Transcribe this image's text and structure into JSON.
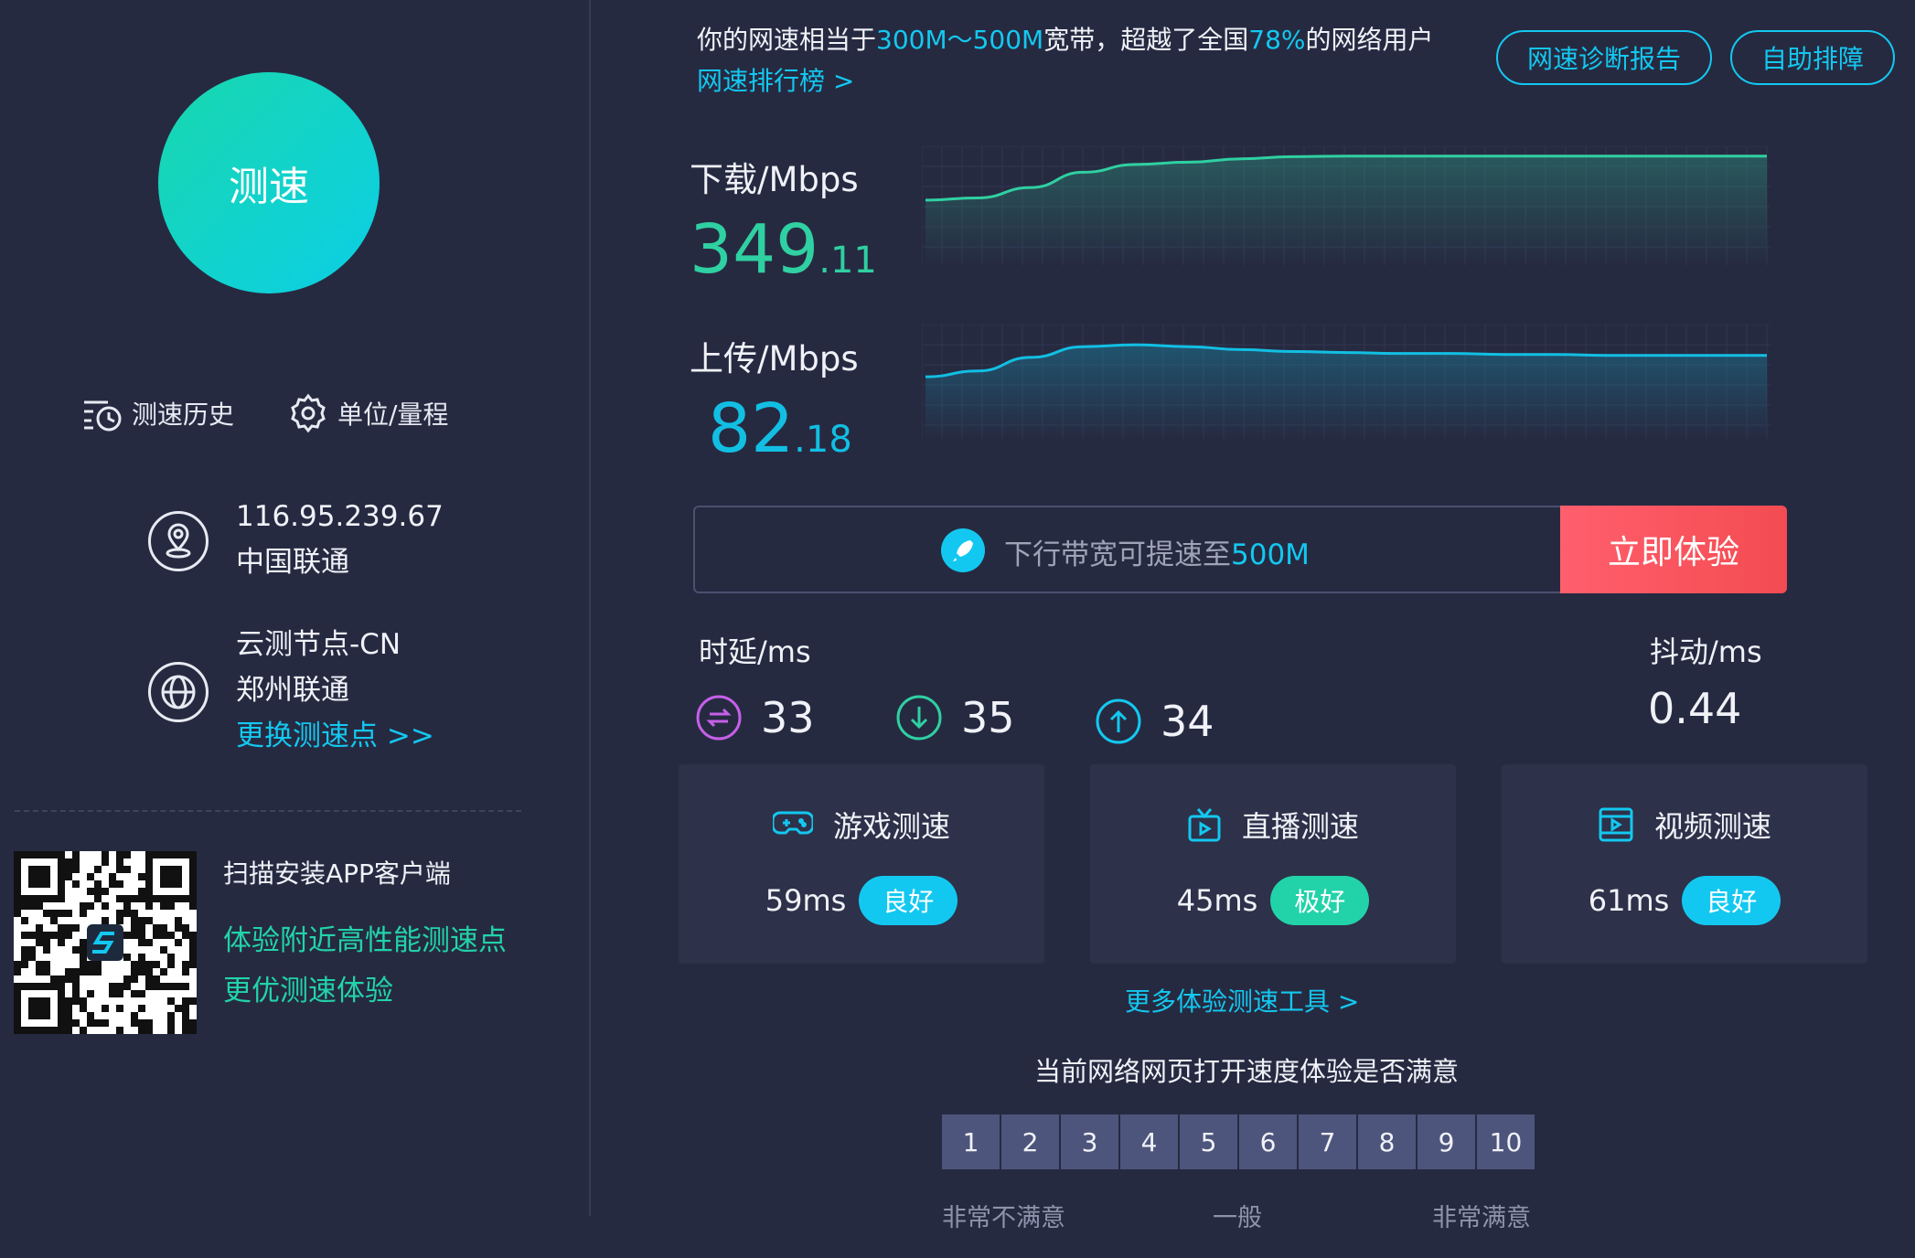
{
  "left": {
    "start_button": "测速",
    "tools": {
      "history": "测速历史",
      "units": "单位/量程"
    },
    "ip": {
      "address": "116.95.239.67",
      "isp": "中国联通"
    },
    "node": {
      "name": "云测节点-CN",
      "location": "郑州联通",
      "change_link": "更换测速点 >>"
    },
    "qr": {
      "title": "扫描安装APP客户端",
      "line1": "体验附近高性能测速点",
      "line2": "更优测速体验"
    }
  },
  "summary": {
    "prefix": "你的网速相当于",
    "bandwidth": "300M～500M",
    "middle": "宽带，超越了全国",
    "percent": "78%",
    "suffix": "的网络用户",
    "ranking_link": "网速排行榜 >"
  },
  "header_buttons": {
    "report": "网速诊断报告",
    "troubleshoot": "自助排障"
  },
  "download": {
    "label": "下载/Mbps",
    "int": "349",
    "dec": ".11"
  },
  "upload": {
    "label": "上传/Mbps",
    "int": "82",
    "dec": ".18"
  },
  "chart_data": [
    {
      "type": "area",
      "x": [
        0,
        1,
        2,
        3,
        4,
        5,
        6,
        7,
        8,
        9,
        10,
        11,
        12,
        13,
        14,
        15,
        16
      ],
      "series": [
        {
          "values": [
            220,
            228,
            265,
            320,
            348,
            356,
            368,
            376,
            378,
            378,
            378,
            378,
            378,
            378,
            378,
            378,
            378
          ]
        }
      ],
      "ylim": [
        0,
        400
      ],
      "grid": true,
      "color": "#2fd0a1"
    },
    {
      "type": "area",
      "x": [
        0,
        1,
        2,
        3,
        4,
        5,
        6,
        7,
        8,
        9,
        10,
        11,
        12,
        13,
        14,
        15,
        16
      ],
      "series": [
        {
          "values": [
            60,
            66,
            80,
            91,
            93,
            91,
            88,
            86,
            85,
            84,
            84,
            83,
            83,
            82,
            82,
            82,
            82
          ]
        }
      ],
      "ylim": [
        0,
        110
      ],
      "grid": true,
      "color": "#12bfe3"
    }
  ],
  "boost": {
    "text_prefix": "下行带宽可提速至",
    "text_value": "500M",
    "button": "立即体验"
  },
  "latency": {
    "label": "时延/ms",
    "total": "33",
    "down": "35",
    "up": "34"
  },
  "jitter": {
    "label": "抖动/ms",
    "value": "0.44"
  },
  "cards": [
    {
      "title": "游戏测速",
      "ms": "59ms",
      "badge": "良好",
      "badge_color": "#13c8f0"
    },
    {
      "title": "直播测速",
      "ms": "45ms",
      "badge": "极好",
      "badge_color": "#22d3a9"
    },
    {
      "title": "视频测速",
      "ms": "61ms",
      "badge": "良好",
      "badge_color": "#13c8f0"
    }
  ],
  "more_tools": "更多体验测速工具 >",
  "survey": {
    "title": "当前网络网页打开速度体验是否满意",
    "options": [
      "1",
      "2",
      "3",
      "4",
      "5",
      "6",
      "7",
      "8",
      "9",
      "10"
    ],
    "low": "非常不满意",
    "mid": "一般",
    "high": "非常满意"
  },
  "colors": {
    "background": "#262a41",
    "accent_blue": "#13c8f0",
    "accent_green": "#22d3a9",
    "cta_red": "#f44b52",
    "download_color": "#2fd0a1",
    "upload_color": "#12bfe3"
  }
}
